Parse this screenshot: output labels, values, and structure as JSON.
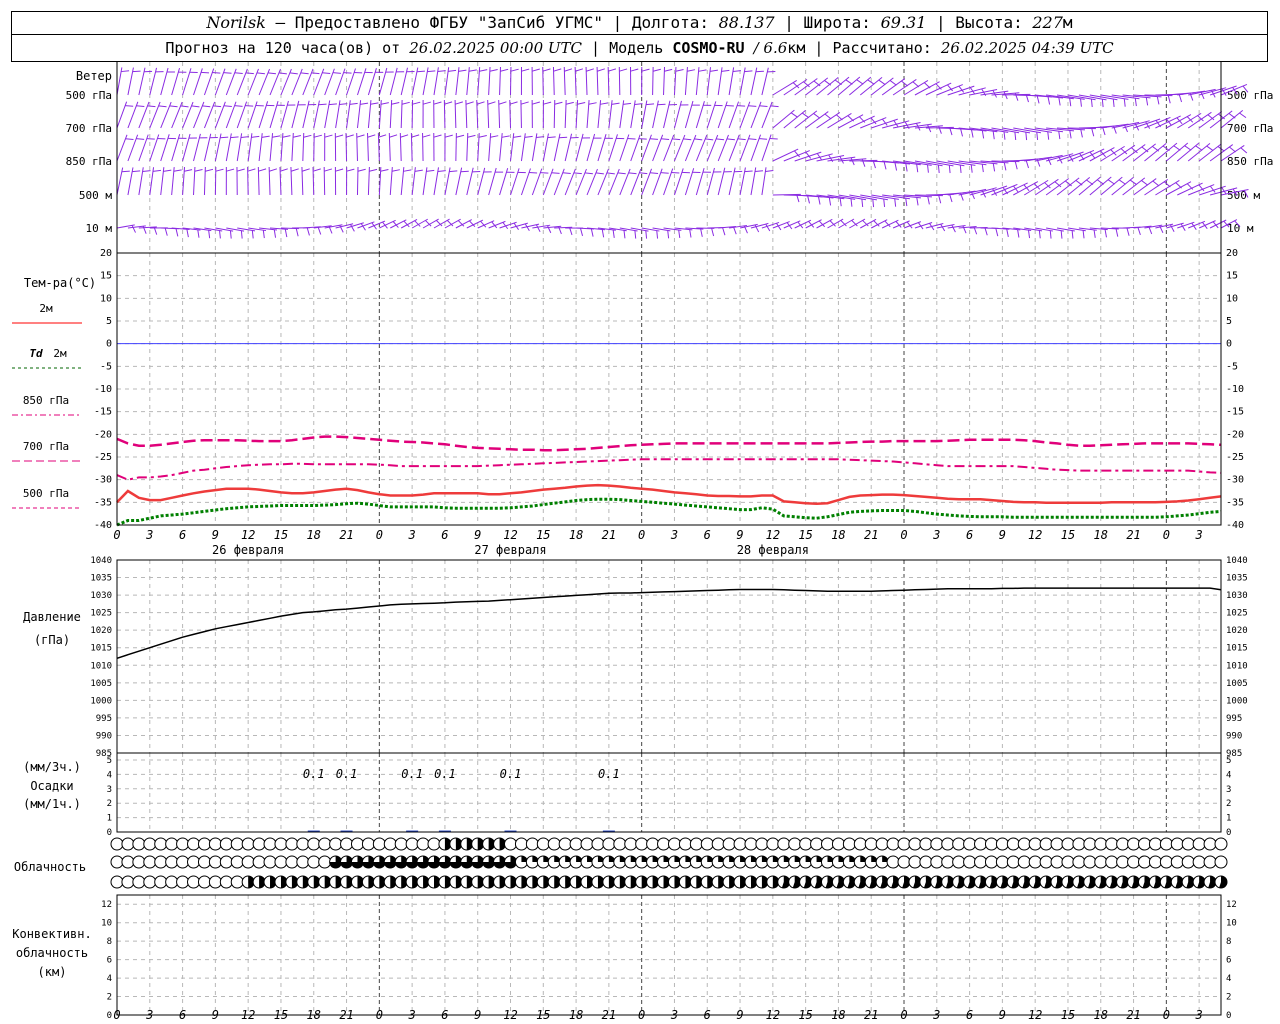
{
  "header": {
    "station": "Norilsk",
    "provider": "– Предоставлено ФГБУ \"ЗапСиб УГМС\" |",
    "lon_label": "Долгота:",
    "lon_value": "88.137",
    "lat_label": "| Широта:",
    "lat_value": "69.31",
    "alt_label": "| Высота:",
    "alt_value": "227",
    "alt_unit": "м",
    "forecast_prefix": "Прогноз на 120 часа(ов) от",
    "forecast_time": "26.02.2025 00:00 UTC",
    "model_label": "| Модель",
    "model_name": "COSMO-RU",
    "model_res": "/ 6.6",
    "model_res_unit": "км",
    "calc_label": "| Рассчитано:",
    "calc_time": "26.02.2025 04:39 UTC"
  },
  "chart_data": [
    {
      "type": "line",
      "panel": "wind",
      "title": "Ветер",
      "levels": [
        "500 гПа",
        "700 гПа",
        "850 гПа",
        "500 м",
        "10  м"
      ],
      "level_units": "",
      "note": ""
    },
    {
      "type": "line",
      "panel": "temperature",
      "title": "Тем-ра(°С)",
      "ylim": [
        -40,
        20
      ],
      "yticks": [
        20,
        15,
        10,
        5,
        0,
        -5,
        -10,
        -15,
        -20,
        -25,
        -30,
        -35,
        -40
      ],
      "legend": [
        {
          "label": "2м",
          "prefix": "",
          "color": "#ff0000",
          "dash": "solid"
        },
        {
          "label": "2м",
          "prefix": "Td",
          "color": "#006400",
          "dash": "dot"
        },
        {
          "label": "850 гПа",
          "prefix": "",
          "color": "#e0007a",
          "dash": "dash-dot"
        },
        {
          "label": "700 гПа",
          "prefix": "",
          "color": "#e0007a",
          "dash": "dash"
        },
        {
          "label": "500 гПа",
          "prefix": "",
          "color": "#e0007a",
          "dash": "short-dash"
        }
      ],
      "series": [
        {
          "name": "2м",
          "color": "#ee3b3b",
          "values": [
            -35,
            -32.5,
            -34,
            -34.5,
            -34.5,
            -34,
            -33.5,
            -33,
            -32.6,
            -32.3,
            -32,
            -32,
            -32,
            -32.2,
            -32.5,
            -32.8,
            -33,
            -33,
            -32.8,
            -32.5,
            -32.2,
            -32,
            -32.3,
            -32.8,
            -33.2,
            -33.5,
            -33.5,
            -33.5,
            -33.3,
            -33,
            -33,
            -33,
            -33,
            -33,
            -33.2,
            -33.2,
            -33,
            -32.8,
            -32.5,
            -32.2,
            -32,
            -31.8,
            -31.5,
            -31.3,
            -31.2,
            -31.3,
            -31.5,
            -31.8,
            -32,
            -32.2,
            -32.5,
            -32.8,
            -33,
            -33.2,
            -33.5,
            -33.6,
            -33.6,
            -33.7,
            -33.7,
            -33.5,
            -33.5,
            -34.8,
            -35,
            -35.2,
            -35.3,
            -35.2,
            -34.5,
            -33.8,
            -33.5,
            -33.4,
            -33.3,
            -33.3,
            -33.4,
            -33.6,
            -33.8,
            -34,
            -34.2,
            -34.3,
            -34.3,
            -34.3,
            -34.5,
            -34.7,
            -34.9,
            -35,
            -35,
            -35.1,
            -35.1,
            -35.1,
            -35.1,
            -35.1,
            -35.1,
            -35,
            -35,
            -35,
            -35,
            -35,
            -34.9,
            -34.8,
            -34.6,
            -34.3,
            -34,
            -33.7
          ]
        },
        {
          "name": "Td 2м",
          "color": "#008000",
          "values": [
            -40,
            -39,
            -39,
            -38.5,
            -38,
            -37.8,
            -37.6,
            -37.3,
            -37,
            -36.7,
            -36.4,
            -36.2,
            -36,
            -35.9,
            -35.8,
            -35.7,
            -35.7,
            -35.7,
            -35.7,
            -35.6,
            -35.5,
            -35.3,
            -35.2,
            -35.4,
            -35.7,
            -36,
            -36,
            -36,
            -36,
            -36,
            -36.2,
            -36.3,
            -36.3,
            -36.3,
            -36.3,
            -36.3,
            -36.2,
            -36,
            -35.8,
            -35.5,
            -35.2,
            -34.9,
            -34.6,
            -34.4,
            -34.3,
            -34.3,
            -34.4,
            -34.6,
            -34.8,
            -35,
            -35.2,
            -35.4,
            -35.6,
            -35.8,
            -36,
            -36.2,
            -36.4,
            -36.6,
            -36.6,
            -36.2,
            -36.5,
            -38,
            -38.2,
            -38.4,
            -38.5,
            -38.2,
            -37.7,
            -37.2,
            -37,
            -36.9,
            -36.8,
            -36.8,
            -36.8,
            -37,
            -37.3,
            -37.6,
            -37.8,
            -38,
            -38.1,
            -38.2,
            -38.2,
            -38.2,
            -38.3,
            -38.3,
            -38.3,
            -38.3,
            -38.3,
            -38.3,
            -38.3,
            -38.3,
            -38.3,
            -38.3,
            -38.3,
            -38.3,
            -38.3,
            -38.3,
            -38.2,
            -38,
            -37.8,
            -37.5,
            -37.2,
            -37
          ]
        },
        {
          "name": "850 гПа",
          "color": "#e0007a",
          "values": [
            -29,
            -30,
            -29.5,
            -29.5,
            -29.3,
            -29,
            -28.5,
            -28,
            -27.8,
            -27.5,
            -27.2,
            -27,
            -26.8,
            -26.7,
            -26.6,
            -26.6,
            -26.5,
            -26.5,
            -26.6,
            -26.6,
            -26.6,
            -26.6,
            -26.6,
            -26.6,
            -26.7,
            -26.8,
            -27,
            -27,
            -27,
            -27,
            -27,
            -27,
            -27,
            -27,
            -26.9,
            -26.8,
            -26.7,
            -26.6,
            -26.5,
            -26.4,
            -26.3,
            -26.2,
            -26.1,
            -26,
            -25.9,
            -25.8,
            -25.7,
            -25.6,
            -25.5,
            -25.5,
            -25.5,
            -25.5,
            -25.5,
            -25.5,
            -25.5,
            -25.5,
            -25.5,
            -25.5,
            -25.5,
            -25.5,
            -25.5,
            -25.5,
            -25.5,
            -25.5,
            -25.5,
            -25.5,
            -25.5,
            -25.6,
            -25.7,
            -25.8,
            -25.9,
            -26,
            -26.2,
            -26.4,
            -26.6,
            -26.8,
            -27,
            -27,
            -27,
            -27,
            -27,
            -27,
            -27,
            -27.2,
            -27.4,
            -27.6,
            -27.8,
            -27.9,
            -28,
            -28,
            -28,
            -28,
            -28,
            -28,
            -28,
            -28,
            -28,
            -28,
            -28,
            -28.2,
            -28.4,
            -28.5
          ]
        },
        {
          "name": "700 гПа",
          "color": "#e0007a",
          "values": [
            -21,
            -22,
            -22.5,
            -22.5,
            -22.3,
            -22,
            -21.7,
            -21.4,
            -21.3,
            -21.3,
            -21.3,
            -21.3,
            -21.4,
            -21.5,
            -21.5,
            -21.5,
            -21.3,
            -21,
            -20.7,
            -20.5,
            -20.5,
            -20.6,
            -20.8,
            -21,
            -21.2,
            -21.4,
            -21.6,
            -21.7,
            -21.8,
            -22,
            -22.2,
            -22.5,
            -22.8,
            -23,
            -23.1,
            -23.2,
            -23.3,
            -23.4,
            -23.4,
            -23.5,
            -23.5,
            -23.4,
            -23.3,
            -23.2,
            -23,
            -22.8,
            -22.6,
            -22.4,
            -22.3,
            -22.2,
            -22.1,
            -22,
            -22,
            -22,
            -22,
            -22,
            -22,
            -22,
            -22,
            -22,
            -22,
            -22,
            -22,
            -22,
            -22,
            -22,
            -21.9,
            -21.8,
            -21.7,
            -21.6,
            -21.6,
            -21.5,
            -21.5,
            -21.5,
            -21.5,
            -21.5,
            -21.4,
            -21.3,
            -21.2,
            -21.2,
            -21.2,
            -21.2,
            -21.2,
            -21.3,
            -21.5,
            -21.8,
            -22,
            -22.3,
            -22.5,
            -22.5,
            -22.4,
            -22.3,
            -22.2,
            -22.1,
            -22,
            -22,
            -22,
            -22,
            -22,
            -22.1,
            -22.2,
            -22.3
          ]
        },
        {
          "name": "500 гПа",
          "color": "#e0007a",
          "values": []
        }
      ],
      "xlabel": "",
      "ylabel": ""
    },
    {
      "type": "line",
      "panel": "pressure",
      "title": "Давление",
      "ylabel": "(гПа)",
      "ylim": [
        985,
        1040
      ],
      "yticks": [
        1040,
        1035,
        1030,
        1025,
        1020,
        1015,
        1010,
        1005,
        1000,
        995,
        990,
        985
      ],
      "series": [
        {
          "name": "Давление",
          "color": "#000000",
          "values": [
            1012,
            1013,
            1014,
            1015,
            1016,
            1017,
            1018,
            1018.8,
            1019.6,
            1020.4,
            1021,
            1021.6,
            1022.2,
            1022.8,
            1023.4,
            1024,
            1024.5,
            1025,
            1025.2,
            1025.5,
            1025.8,
            1026,
            1026.3,
            1026.6,
            1026.9,
            1027.2,
            1027.4,
            1027.5,
            1027.6,
            1027.7,
            1027.8,
            1028,
            1028.1,
            1028.2,
            1028.3,
            1028.5,
            1028.7,
            1028.9,
            1029.1,
            1029.3,
            1029.5,
            1029.7,
            1029.9,
            1030.1,
            1030.3,
            1030.5,
            1030.6,
            1030.6,
            1030.7,
            1030.8,
            1030.9,
            1031,
            1031.1,
            1031.2,
            1031.3,
            1031.4,
            1031.5,
            1031.6,
            1031.6,
            1031.6,
            1031.6,
            1031.5,
            1031.4,
            1031.3,
            1031.2,
            1031.1,
            1031.1,
            1031.1,
            1031.1,
            1031.1,
            1031.2,
            1031.3,
            1031.4,
            1031.5,
            1031.6,
            1031.7,
            1031.8,
            1031.8,
            1031.8,
            1031.8,
            1031.8,
            1031.9,
            1031.9,
            1032,
            1032,
            1032,
            1032,
            1032,
            1032,
            1032,
            1032,
            1032,
            1032,
            1032,
            1032,
            1032,
            1032,
            1032,
            1032,
            1032,
            1032,
            1031.5
          ]
        }
      ]
    },
    {
      "type": "bar",
      "panel": "precipitation",
      "title": "Осадки",
      "ylabel_top": "(мм/3ч.)",
      "ylabel_bottom": "(мм/1ч.)",
      "ylim": [
        0,
        5
      ],
      "yticks": [
        5,
        4,
        3,
        2,
        1,
        0
      ],
      "values_hours": [
        18,
        21,
        27,
        30,
        36,
        45
      ],
      "values": [
        0.1,
        0.1,
        0.1,
        0.1,
        0.1,
        0.1
      ],
      "labels": [
        "0.1",
        "0.1",
        "0.1",
        "0.1",
        "0.1",
        "0.1"
      ]
    },
    {
      "type": "table",
      "panel": "cloudiness",
      "title": "Облачность",
      "rows": 3,
      "note": ""
    },
    {
      "type": "line",
      "panel": "convective",
      "title_lines": [
        "Конвективн.",
        "облачность",
        "(км)"
      ],
      "ylim": [
        0,
        13
      ],
      "yticks": [
        12,
        10,
        8,
        6,
        4,
        2,
        0
      ],
      "series": []
    }
  ],
  "time_axis": {
    "tick_labels": [
      "0",
      "3",
      "6",
      "9",
      "12",
      "15",
      "18",
      "21",
      "0",
      "3",
      "6",
      "9",
      "12",
      "15",
      "18",
      "21",
      "0",
      "3",
      "6",
      "9",
      "12",
      "15",
      "18",
      "21",
      "0",
      "3",
      "6",
      "9",
      "12",
      "15",
      "18",
      "21",
      "0",
      "3",
      "6"
    ],
    "day_labels": [
      "26 февраля",
      "27 февраля",
      "28 февраля"
    ]
  },
  "colors": {
    "wind": "#8a2be2",
    "grid": "#b8b8b8",
    "zero_line": "#4040ff"
  }
}
